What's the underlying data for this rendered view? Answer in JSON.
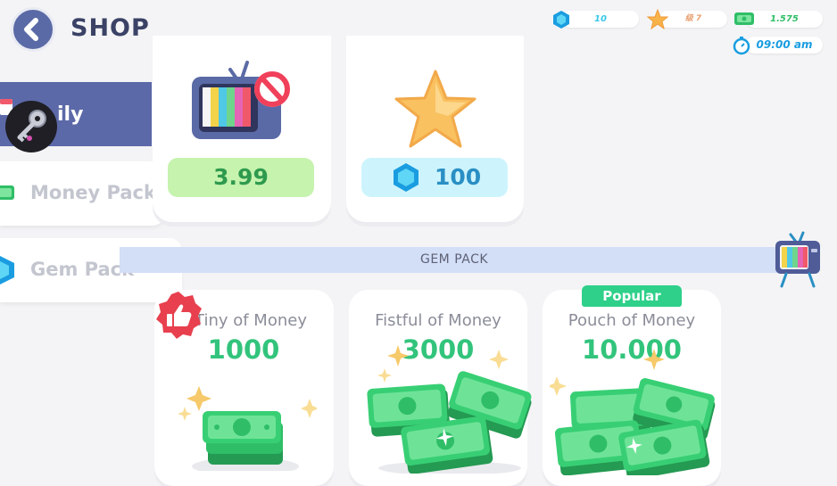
{
  "header": {
    "title": "SHOP"
  },
  "resources": {
    "gems": "10",
    "stars": "级 7",
    "money": "1.575",
    "time": "09:00 am"
  },
  "sidebar": {
    "items": [
      {
        "label": "ily",
        "icon": "calendar-icon",
        "active": true
      },
      {
        "label": "Money Pack",
        "icon": "cash-icon",
        "active": false
      },
      {
        "label": "Gem Pack",
        "icon": "gem-icon",
        "active": false
      }
    ]
  },
  "offers": [
    {
      "price": "3.99",
      "icon": "no-ads-tv-icon"
    },
    {
      "price": "100",
      "icon": "star-icon",
      "currency_icon": "gem-icon"
    }
  ],
  "section": {
    "label": "GEM PACK"
  },
  "packs": [
    {
      "title": "Tiny of Money",
      "amount": "1000"
    },
    {
      "title": "Fistful of Money",
      "amount": "3000"
    },
    {
      "title": "Pouch of Money",
      "amount": "10.000",
      "badge": "Popular"
    }
  ],
  "colors": {
    "accent": "#5c69a8",
    "money_green": "#32c47c",
    "gem_blue": "#39c8e9",
    "price_green_bg": "#c6f3ae",
    "price_blue_bg": "#cdf4fd"
  }
}
